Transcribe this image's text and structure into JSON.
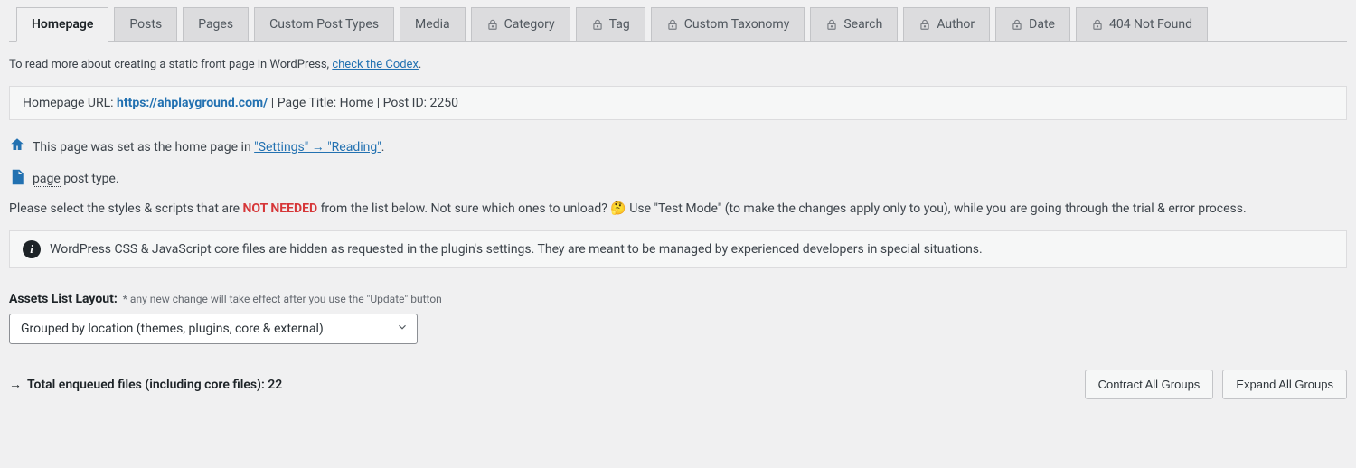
{
  "tabs": [
    {
      "label": "Homepage",
      "locked": false,
      "active": true
    },
    {
      "label": "Posts",
      "locked": false,
      "active": false
    },
    {
      "label": "Pages",
      "locked": false,
      "active": false
    },
    {
      "label": "Custom Post Types",
      "locked": false,
      "active": false
    },
    {
      "label": "Media",
      "locked": false,
      "active": false
    },
    {
      "label": "Category",
      "locked": true,
      "active": false
    },
    {
      "label": "Tag",
      "locked": true,
      "active": false
    },
    {
      "label": "Custom Taxonomy",
      "locked": true,
      "active": false
    },
    {
      "label": "Search",
      "locked": true,
      "active": false
    },
    {
      "label": "Author",
      "locked": true,
      "active": false
    },
    {
      "label": "Date",
      "locked": true,
      "active": false
    },
    {
      "label": "404 Not Found",
      "locked": true,
      "active": false
    }
  ],
  "intro": {
    "prefix": "To read more about creating a static front page in WordPress, ",
    "link_text": "check the Codex",
    "period": "."
  },
  "home_info": {
    "url_label": "Homepage URL: ",
    "url": "https://ahplayground.com/",
    "sep1": " | ",
    "title_label": "Page Title: ",
    "title_value": "Home",
    "sep2": " | ",
    "postid_label": "Post ID: ",
    "postid_value": "2250"
  },
  "home_set": {
    "prefix": "This page was set as the home page in ",
    "link_text": "\"Settings\" → \"Reading\"",
    "period": "."
  },
  "post_type": {
    "page_word": "page",
    "rest": " post type."
  },
  "select_text": {
    "a": "Please select the styles & scripts that are ",
    "not_needed": "NOT NEEDED",
    "b": " from the list below. Not sure which ones to unload? ",
    "emoji": "🤔",
    "c": " Use \"Test Mode\" (to make the changes apply only to you), while you are going through the trial & error process."
  },
  "core_files_msg": "WordPress CSS & JavaScript core files are hidden as requested in the plugin's settings. They are meant to be managed by experienced developers in special situations.",
  "layout": {
    "label": "Assets List Layout:",
    "hint": "* any new change will take effect after you use the \"Update\" button",
    "selected": "Grouped by location (themes, plugins, core & external)"
  },
  "total": {
    "arrow": "→",
    "label": "Total enqueued files (including core files): ",
    "value": "22"
  },
  "buttons": {
    "contract": "Contract All Groups",
    "expand": "Expand All Groups"
  }
}
